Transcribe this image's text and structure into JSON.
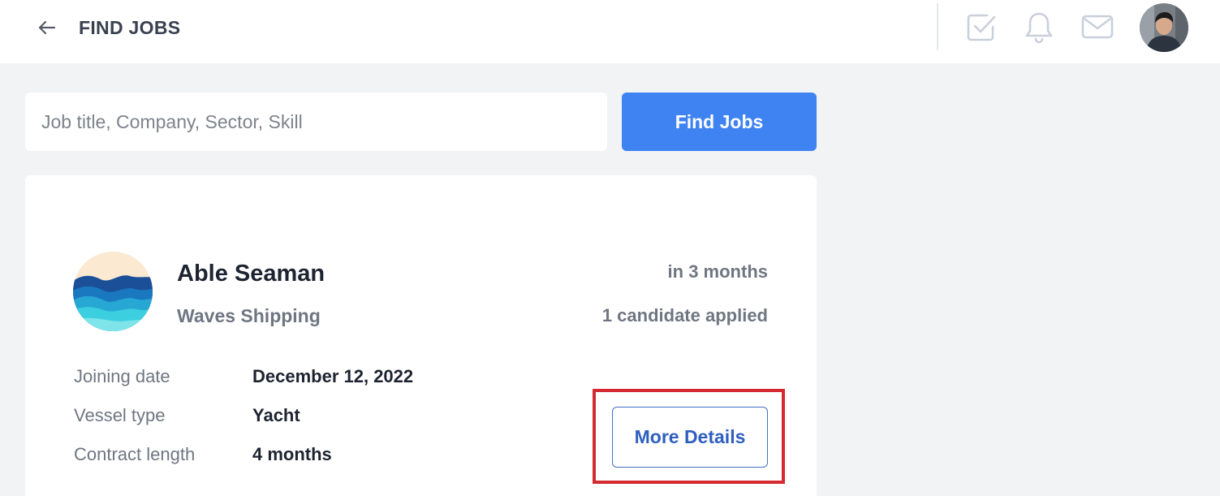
{
  "header": {
    "title": "FIND JOBS",
    "icons": [
      "arrow-left-icon",
      "checkbox-icon",
      "bell-icon",
      "mail-icon"
    ]
  },
  "search": {
    "placeholder": "Job title, Company, Sector, Skill",
    "value": "",
    "button_label": "Find Jobs"
  },
  "job": {
    "title": "Able Seaman",
    "company": "Waves Shipping",
    "posted": "in 3 months",
    "applicants": "1 candidate applied",
    "details": [
      {
        "label": "Joining date",
        "value": "December 12, 2022"
      },
      {
        "label": "Vessel type",
        "value": "Yacht"
      },
      {
        "label": "Contract length",
        "value": "4 months"
      }
    ],
    "more_label": "More Details"
  },
  "colors": {
    "accent": "#3f83f3",
    "highlight": "#d42a31",
    "link": "#2f5fbf"
  }
}
